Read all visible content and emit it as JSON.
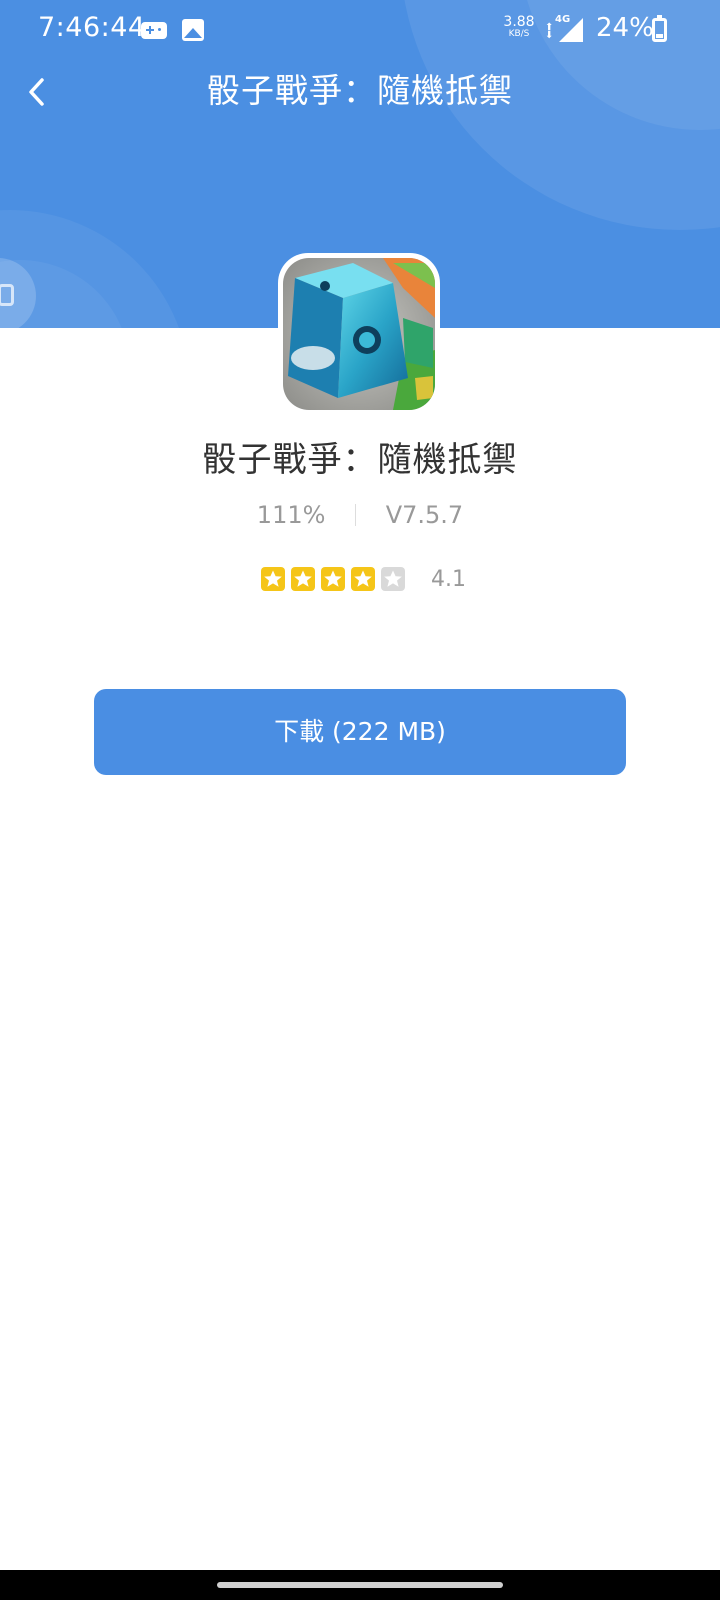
{
  "status_bar": {
    "time": "7:46:44",
    "speed_value": "3.88",
    "speed_unit": "KB/S",
    "network": "4G",
    "battery_percent": "24%",
    "battery_level": 0.24,
    "icons": [
      "game-controller-icon",
      "image-icon",
      "signal-icon",
      "battery-icon"
    ]
  },
  "app_bar": {
    "title": "骰子戰爭：隨機抵禦",
    "back_icon": "chevron-left-icon"
  },
  "app": {
    "name": "骰子戰爭：隨機抵禦",
    "stat": "111%",
    "version": "V7.5.7",
    "rating_value": "4.1",
    "rating_stars": 4,
    "rating_max": 5
  },
  "download": {
    "label": "下載 (222 MB)"
  },
  "colors": {
    "header_blue": "#4b8fe2",
    "button_blue": "#4a8ee3",
    "star_filled": "#f5c518",
    "star_empty": "#d9d9d9"
  }
}
